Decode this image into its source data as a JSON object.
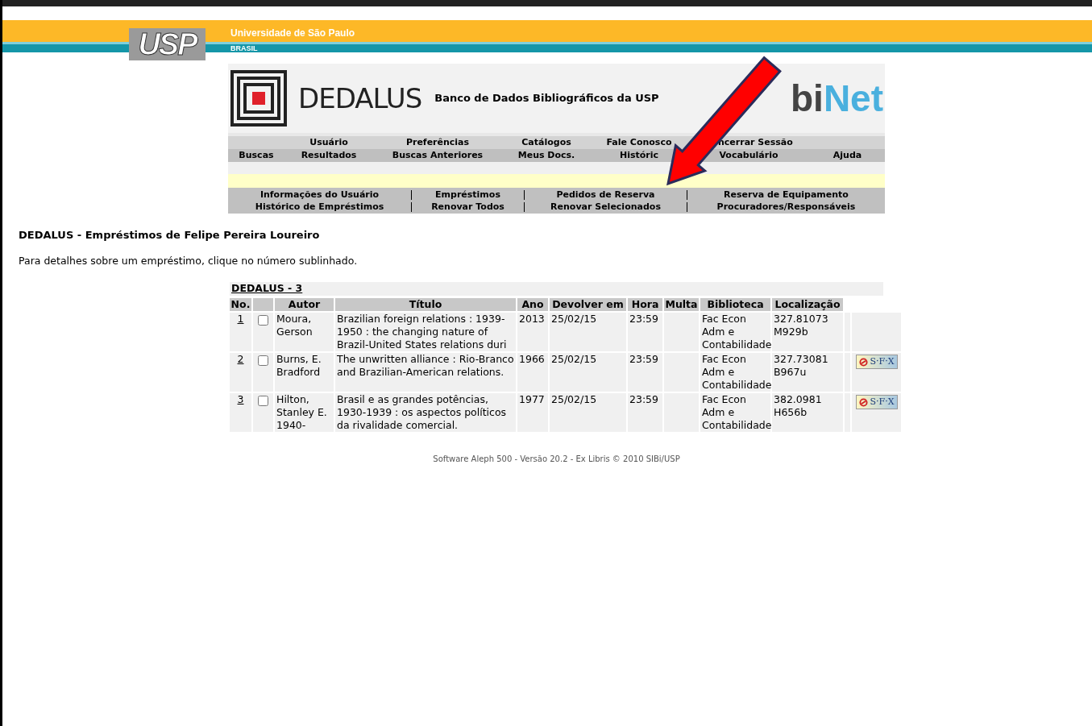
{
  "top_banner": {
    "logo": "USP",
    "university": "Universidade de São Paulo",
    "country": "BRASIL"
  },
  "header": {
    "logo_text": "DEDALUS",
    "subtitle": "Banco de Dados Bibliográficos da USP",
    "brand_part_1": "bi",
    "brand_part_2": "Net"
  },
  "main_menu": {
    "row_1": [
      "Usuário",
      "Preferências",
      "Catálogos",
      "Fale Conosco",
      "ncerrar Sessão"
    ],
    "row_2": [
      "Buscas",
      "Resultados",
      "Buscas Anteriores",
      "Meus Docs.",
      "Históric",
      "Vocabulário",
      "Ajuda"
    ]
  },
  "sub_menu": {
    "row_1": [
      "Informações do Usuário",
      "Empréstimos",
      "Pedidos de Reserva",
      "Reserva de Equipamento"
    ],
    "row_2": [
      "Histórico de Empréstimos",
      "Renovar Todos",
      "Renovar Selecionados",
      "Procuradores/Responsáveis"
    ]
  },
  "page_title": "DEDALUS - Empréstimos de Felipe Pereira Loureiro",
  "instructions": "Para detalhes sobre um empréstimo, clique no número sublinhado.",
  "table": {
    "caption": "DEDALUS - 3",
    "columns": [
      "No.",
      "Autor",
      "Título",
      "Ano",
      "Devolver em",
      "Hora",
      "Multa",
      "Biblioteca",
      "Localização"
    ],
    "rows": [
      {
        "no": "1",
        "checked": false,
        "autor": "Moura, Gerson",
        "titulo": "Brazilian foreign relations : 1939-1950 : the changing nature of Brazil-United States relations duri",
        "ano": "2013",
        "devolver_em": "25/02/15",
        "hora": "23:59",
        "biblioteca": "Fac Econ Adm e Contabilidade",
        "localizacao": "327.81073 M929b"
      },
      {
        "no": "2",
        "checked": false,
        "autor": "Burns, E. Bradford",
        "titulo": "The unwritten alliance : Rio-Branco and Brazilian-American relations.",
        "ano": "1966",
        "devolver_em": "25/02/15",
        "hora": "23:59",
        "biblioteca": "Fac Econ Adm e Contabilidade",
        "localizacao": "327.73081 B967u",
        "sfx_label": "S·F·X"
      },
      {
        "no": "3",
        "checked": false,
        "autor": "Hilton, Stanley E. 1940-",
        "titulo": "Brasil e as grandes potências, 1930-1939 : os aspectos políticos da rivalidade comercial.",
        "ano": "1977",
        "devolver_em": "25/02/15",
        "hora": "23:59",
        "biblioteca": "Fac Econ Adm e Contabilidade",
        "localizacao": "382.0981 H656b",
        "sfx_label": "S·F·X"
      }
    ]
  },
  "footer": "Software Aleph 500 - Versão 20.2 - Ex Libris © 2010 SIBi/USP"
}
